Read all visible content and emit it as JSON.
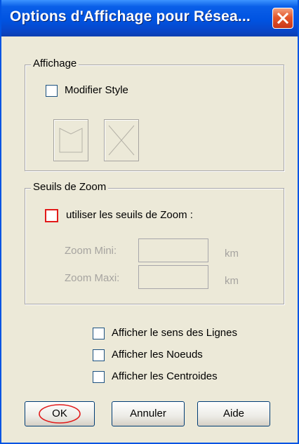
{
  "window": {
    "title": "Options d'Affichage pour Résea..."
  },
  "affichage_group": {
    "legend": "Affichage",
    "modifier_style_label": "Modifier Style",
    "modifier_style_checked": false
  },
  "zoom_group": {
    "legend": "Seuils de Zoom",
    "use_thresholds_label": "utiliser les seuils de Zoom :",
    "use_thresholds_checked": false,
    "zoom_min_label": "Zoom Mini:",
    "zoom_min_value": "",
    "zoom_min_unit": "km",
    "zoom_max_label": "Zoom Maxi:",
    "zoom_max_value": "",
    "zoom_max_unit": "km"
  },
  "display_options": {
    "sens_lignes_label": "Afficher le sens des Lignes",
    "noeuds_label": "Afficher les Noeuds",
    "centroides_label": "Afficher les Centroides"
  },
  "buttons": {
    "ok": "OK",
    "annuler": "Annuler",
    "aide": "Aide"
  },
  "colors": {
    "title_bar": "#0053e1",
    "dialog_bg": "#ece9d8",
    "highlight": "#e21a1a"
  },
  "icons": [
    "close-icon",
    "line-style-icon",
    "cross-style-icon"
  ]
}
